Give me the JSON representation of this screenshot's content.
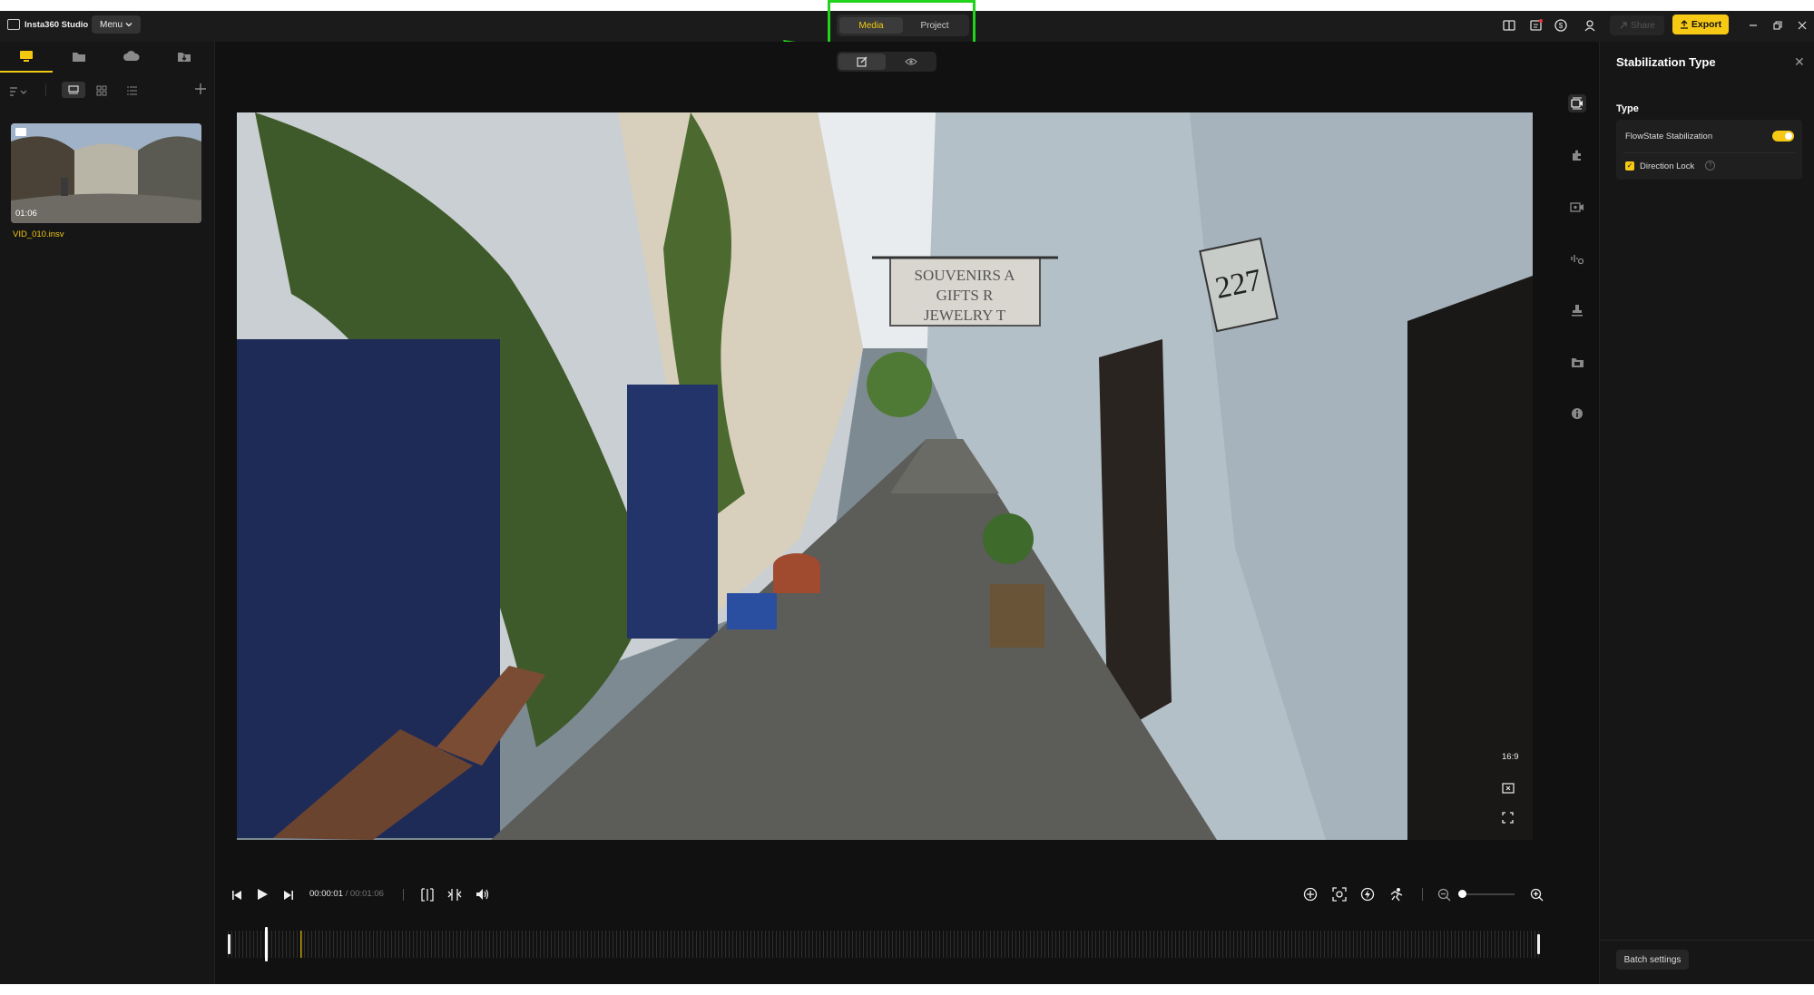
{
  "app": {
    "name": "Insta360 Studio",
    "menu_label": "Menu"
  },
  "mode_tabs": {
    "media": "Media",
    "project": "Project",
    "active": "Media"
  },
  "toolbar": {
    "share_label": "Share",
    "export_label": "Export"
  },
  "left_panel": {
    "tabs": [
      "local-media",
      "folder",
      "cloud",
      "import"
    ],
    "media_items": [
      {
        "name": "VID_010.insv",
        "duration": "01:06"
      }
    ]
  },
  "preview": {
    "aspect_ratio": "16:9",
    "sign_text": [
      "SOUVENIRS A",
      "GIFTS R",
      "JEWELRY T"
    ],
    "house_number": "227"
  },
  "playback": {
    "current_time": "00:00:01",
    "separator": "/",
    "total_time": "00:01:06"
  },
  "right_panel": {
    "title": "Stabilization Type",
    "section_label": "Type",
    "flowstate_label": "FlowState Stabilization",
    "flowstate_on": true,
    "direction_lock_label": "Direction Lock",
    "direction_lock_checked": true,
    "batch_settings_label": "Batch settings"
  },
  "colors": {
    "accent": "#f6c915",
    "highlight_box": "#22d31c",
    "background": "#111111"
  }
}
